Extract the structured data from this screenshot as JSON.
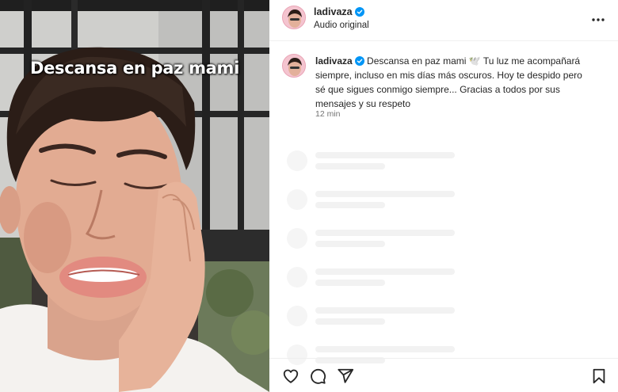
{
  "post": {
    "video_overlay_text": "Descansa en paz mami",
    "header": {
      "username": "ladivaza",
      "audio_label": "Audio original"
    },
    "caption": {
      "username": "ladivaza",
      "text": "Descansa en paz mami 🕊️ Tu luz me acompañará siempre, incluso en mis días más oscuros. Hoy te despido pero sé que sigues conmigo siempre... Gracias a todos por sus mensajes y su respeto",
      "time": "12 min"
    },
    "comments_loading_rows": 6,
    "icons": {
      "verified": "verified-badge-icon",
      "more": "more-options-icon",
      "like": "heart-icon",
      "comment": "comment-icon",
      "share": "share-icon",
      "save": "bookmark-icon"
    },
    "colors": {
      "verified_blue": "#0095f6",
      "text": "#262626",
      "secondary_text": "#737373",
      "skeleton": "#f2f2f2"
    }
  }
}
